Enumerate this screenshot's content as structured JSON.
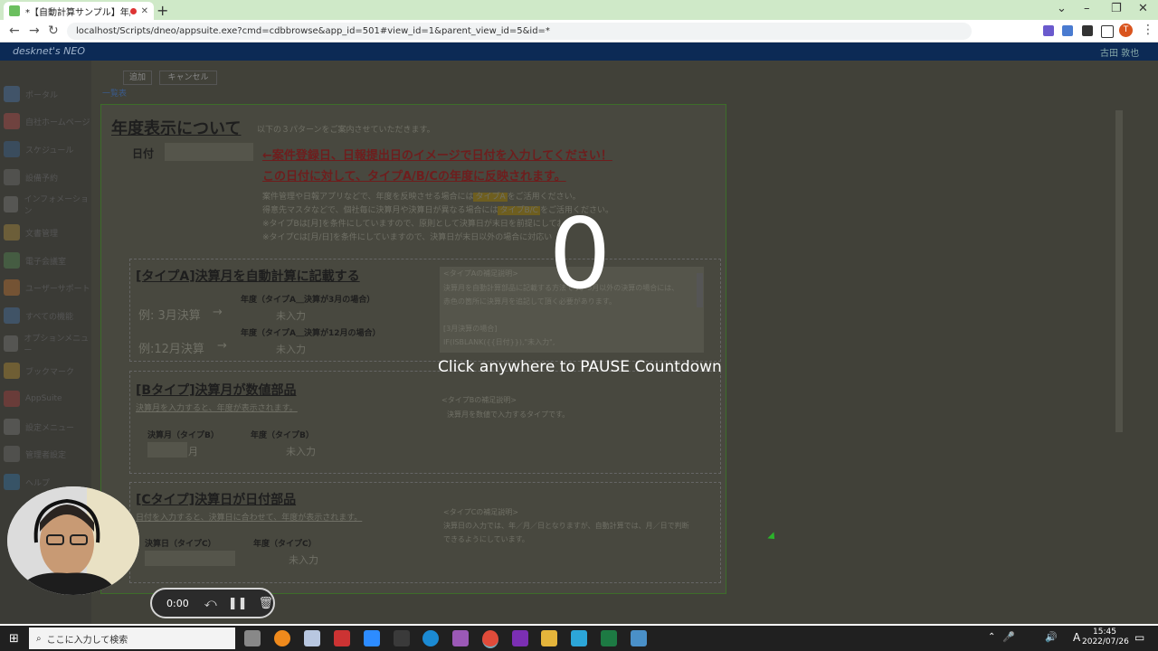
{
  "browser": {
    "tab_title": "*【自動計算サンプル】年度表示",
    "url": "localhost/Scripts/dneo/appsuite.exe?cmd=cdbbrowse&app_id=501#view_id=1&parent_view_id=5&id=*",
    "profile_initial": "T"
  },
  "app": {
    "brand": "desknet's NEO",
    "user_name": "古田 敦也",
    "toolbar": {
      "add": "追加",
      "cancel": "キャンセル",
      "list": "一覧表"
    },
    "sidebar": [
      {
        "label": "ポータル",
        "color": "#4c84c8"
      },
      {
        "label": "自社ホームページ",
        "color": "#d05050"
      },
      {
        "label": "スケジュール",
        "color": "#3a6ea5"
      },
      {
        "label": "設備予約",
        "color": "#7a7a7a"
      },
      {
        "label": "インフォメーション",
        "color": "#8a8a8a"
      },
      {
        "label": "文書管理",
        "color": "#c8a040"
      },
      {
        "label": "電子会議室",
        "color": "#5a9a5a"
      },
      {
        "label": "ユーザーサポート",
        "color": "#e08030"
      },
      {
        "label": "すべての機能",
        "color": "#4a80c0"
      },
      {
        "label": "オプションメニュー",
        "color": "#888"
      },
      {
        "label": "ブックマーク",
        "color": "#d0a030"
      },
      {
        "label": "AppSuite",
        "color": "#c04040"
      },
      {
        "label": "設定メニュー",
        "color": "#888"
      },
      {
        "label": "管理者設定",
        "color": "#777"
      },
      {
        "label": "ヘルプ",
        "color": "#3080c0"
      }
    ],
    "panel": {
      "title": "年度表示について",
      "subtitle": "以下の３パターンをご案内させていただきます。",
      "date_label": "日付",
      "red_line1": "←案件登録日、日報提出日のイメージで日付を入力してください！",
      "red_line2": "この日付に対して、タイプA/B/Cの年度に反映されます。",
      "note1a": "案件管理や日報アプリなどで、年度を反映させる場合には",
      "note1_hl": "タイプA",
      "note1b": "をご活用ください。",
      "note2a": "得意先マスタなどで、個社毎に決算月や決算日が異なる場合には",
      "note2_hl": "タイプB/C",
      "note2b": "をご活用ください。",
      "note3": "※タイプBは[月]を条件にしていますので、原則として決算日が末日を前提にしております。",
      "note4": "※タイプCは[月/日]を条件にしていますので、決算日が末日以外の場合に対応いたします。",
      "typeA": {
        "heading": "[タイプA]決算月を自動計算に記載する",
        "ex1_label": "例: 3月決算",
        "ex1_field_label": "年度（タイプA＿決算が3月の場合）",
        "ex1_value": "未入力",
        "ex2_label": "例:12月決算",
        "ex2_field_label": "年度（タイプA＿決算が12月の場合）",
        "ex2_value": "未入力",
        "arrow": "→",
        "note_title": "<タイプAの補足説明>",
        "note_body1": "決算月を自動計算部品に記載する方法です。3月以外の決算の場合には、",
        "note_body2": "赤色の箇所に決算月を追記して頂く必要があります。",
        "note_body3": "[3月決算の場合]",
        "note_body4": "IF(ISBLANK({{日付}}),\"未入力\","
      },
      "typeB": {
        "heading": "[Bタイプ]決算月が数値部品",
        "sub": "決算月を入力すると、年度が表示されます。",
        "field1_label": "決算月（タイプB）",
        "field1_suffix": "月",
        "field2_label": "年度（タイプB）",
        "field2_value": "未入力",
        "note_title": "<タイプBの補足説明>",
        "note_body": "決算月を数値で入力するタイプです。"
      },
      "typeC": {
        "heading": "[Cタイプ]決算日が日付部品",
        "sub": "日付を入力すると、決算日に合わせて、年度が表示されます。",
        "field1_label": "決算日（タイプC）",
        "field2_label": "年度（タイプC）",
        "field2_value": "未入力",
        "note_title": "<タイプCの補足説明>",
        "note_body1": "決算日の入力では、年／月／日となりますが、自動計算では、月／日で判断",
        "note_body2": "できるようにしています。"
      }
    }
  },
  "overlay": {
    "countdown": "0",
    "pause_hint": "Click anywhere to PAUSE Countdown"
  },
  "recorder": {
    "time": "0:00"
  },
  "taskbar": {
    "search_placeholder": "ここに入力して検索",
    "time": "15:45",
    "date": "2022/07/26"
  }
}
